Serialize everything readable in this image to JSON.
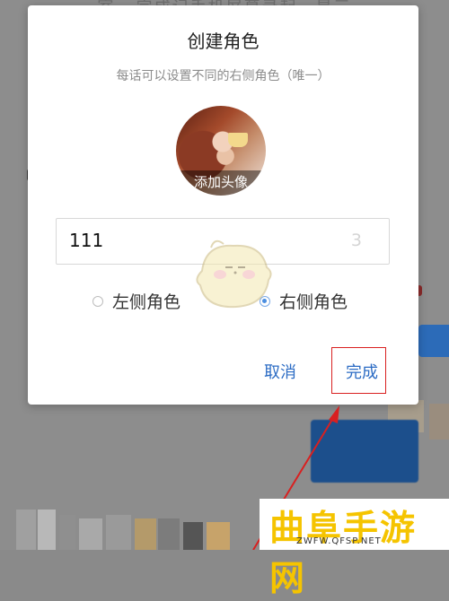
{
  "background": {
    "top_text": "室 · 完成记手机屏幕录起，是三"
  },
  "dialog": {
    "title": "创建角色",
    "subtitle": "每话可以设置不同的右侧角色（唯一）",
    "avatar_label": "添加头像",
    "name_input": {
      "value": "111",
      "char_count": "3"
    },
    "radio_options": [
      {
        "label": "左侧角色",
        "checked": false
      },
      {
        "label": "右侧角色",
        "checked": true
      }
    ],
    "cancel_label": "取消",
    "done_label": "完成"
  },
  "highlight_color": "#d92020",
  "accent_color": "#2c6cc4",
  "watermark": {
    "logo_text": "曲阜手游网",
    "logo_url": "ZWFW.QFSP.NET"
  }
}
